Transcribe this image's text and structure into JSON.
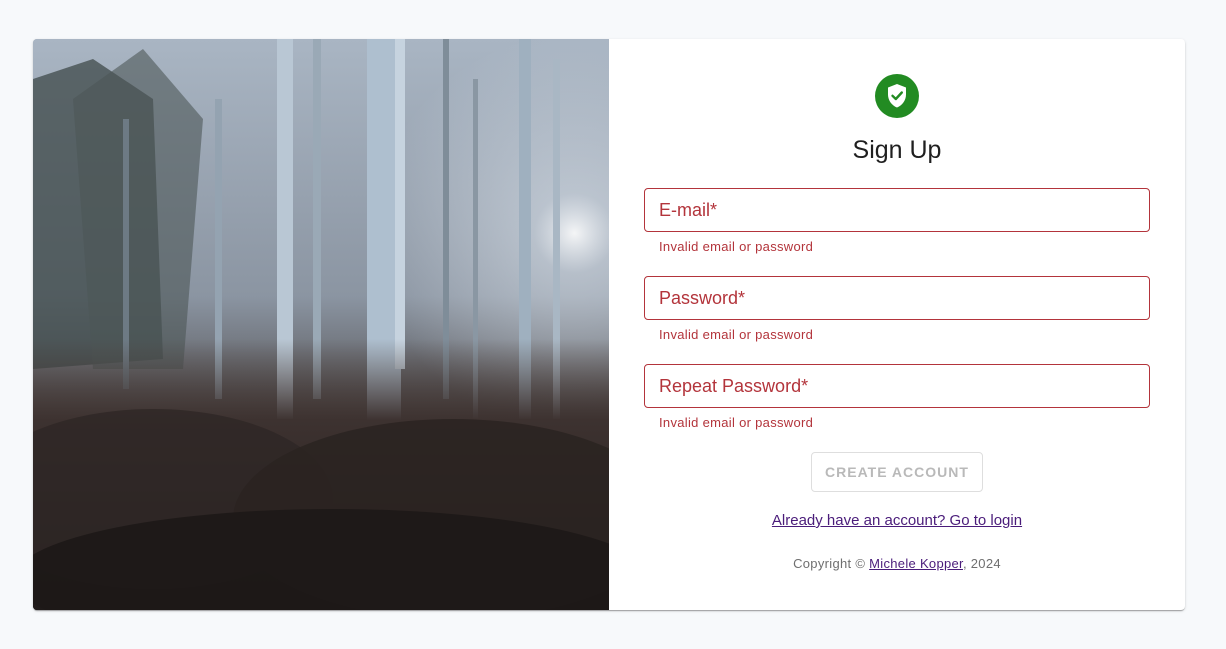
{
  "form": {
    "title": "Sign Up",
    "email_placeholder": "E-mail*",
    "password_placeholder": "Password*",
    "repeat_password_placeholder": "Repeat Password*",
    "email_error": "Invalid email or password",
    "password_error": "Invalid email or password",
    "repeat_password_error": "Invalid email or password",
    "submit_label": "CREATE ACCOUNT",
    "login_link": "Already have an account? Go to login"
  },
  "footer": {
    "copyright_prefix": "Copyright © ",
    "author": "Michele Kopper",
    "copyright_suffix": ", 2024"
  },
  "icons": {
    "avatar": "shield-check-icon",
    "hero": "forest-photo"
  },
  "colors": {
    "accent": "#228b22",
    "error": "#b3343b",
    "link": "#4a1c7a"
  }
}
